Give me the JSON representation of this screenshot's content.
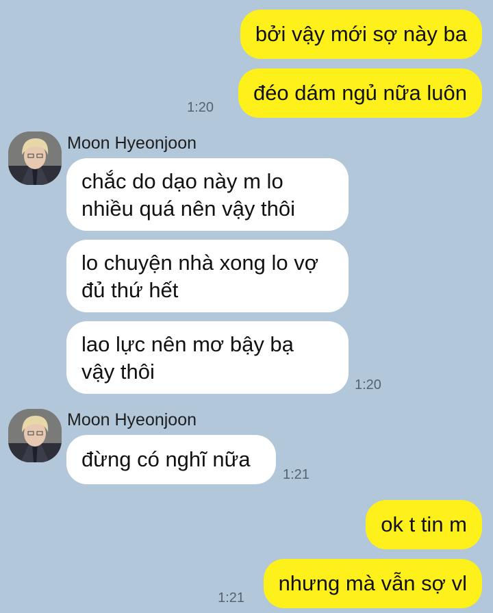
{
  "contact": {
    "name": "Moon Hyeonjoon",
    "avatar_icon": "profile-avatar-icon"
  },
  "colors": {
    "background": "#b2c7d9",
    "outgoing_bubble": "#fef01b",
    "incoming_bubble": "#ffffff",
    "timestamp": "#556270"
  },
  "messages": [
    {
      "direction": "outgoing",
      "text": "bởi vậy mới sợ này ba"
    },
    {
      "direction": "outgoing",
      "text": "đéo dám ngủ nữa luôn",
      "time": "1:20"
    },
    {
      "direction": "incoming",
      "sender": "Moon Hyeonjoon",
      "lines": [
        "chắc do dạo này m lo",
        "nhiều quá nên vậy thôi"
      ]
    },
    {
      "direction": "incoming",
      "lines": [
        "lo chuyện nhà xong lo vợ",
        "đủ thứ hết"
      ]
    },
    {
      "direction": "incoming",
      "lines": [
        "lao lực nên mơ bậy bạ",
        "vậy thôi"
      ],
      "time": "1:20"
    },
    {
      "direction": "incoming",
      "sender": "Moon Hyeonjoon",
      "text": "đừng có nghĩ nữa",
      "time": "1:21"
    },
    {
      "direction": "outgoing",
      "text": "ok t tin m"
    },
    {
      "direction": "outgoing",
      "text": "nhưng mà vẫn sợ vl",
      "time": "1:21"
    }
  ]
}
